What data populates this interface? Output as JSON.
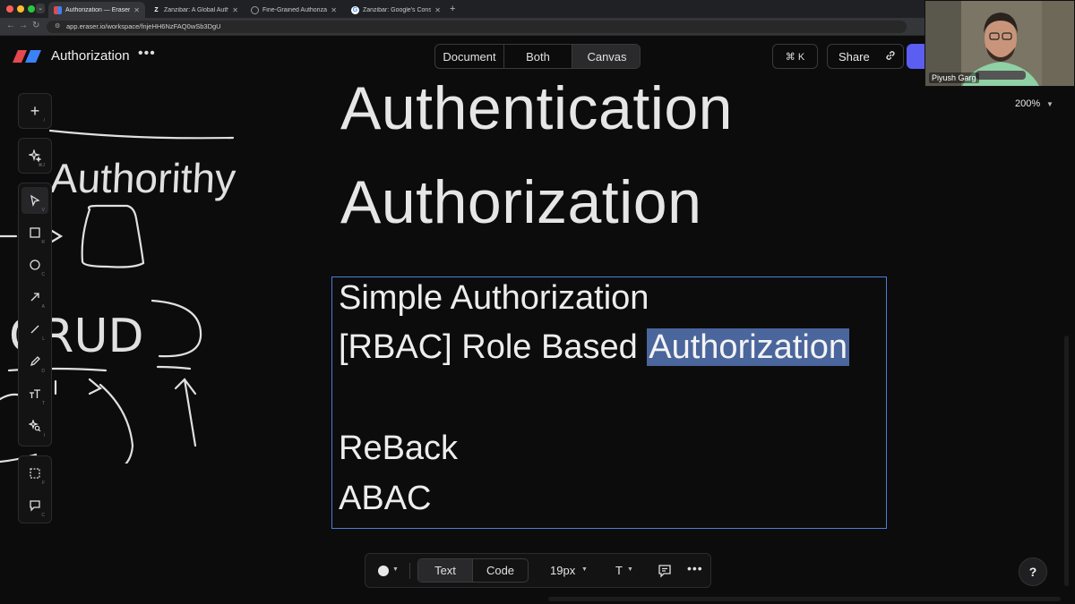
{
  "browser": {
    "tabs": [
      {
        "label": "Authorization — Eraser",
        "favicon": "eraser",
        "active": true
      },
      {
        "label": "Zanzibar: A Global Authorizati",
        "favicon": "Z",
        "active": false
      },
      {
        "label": "Fine-Grained Authorization |",
        "favicon": "globe",
        "active": false
      },
      {
        "label": "Zanzibar: Google's Consisten",
        "favicon": "G",
        "active": false
      }
    ],
    "url": "app.eraser.io/workspace/fnjeHH6NzFAQ0wSb3DgU",
    "new_tab_icon": "plus-icon"
  },
  "header": {
    "title": "Authorization",
    "menu_icon": "more-icon",
    "view_modes": [
      "Document",
      "Both",
      "Canvas"
    ],
    "active_view": "Canvas",
    "command_shortcut": "⌘ K",
    "share_label": "Share",
    "brand_color": "#5b5ef0"
  },
  "webcam": {
    "name": "Piyush Garg"
  },
  "canvas": {
    "zoom": "200%",
    "headings": [
      "Authentication",
      "Authorization"
    ],
    "sketch_text": "Authorithy",
    "sketch_crud": "CRUD",
    "textbox": {
      "lines": [
        "Simple Authorization",
        "[RBAC] Role Based ",
        "ReBack",
        "ABAC"
      ],
      "selected_word": "Authorization",
      "selection_color": "#4a669c"
    }
  },
  "left_toolbar": {
    "tools": [
      {
        "name": "add",
        "key": "/"
      },
      {
        "name": "ai",
        "key": "⌘J"
      },
      {
        "name": "select",
        "key": "V"
      },
      {
        "name": "rectangle",
        "key": "R"
      },
      {
        "name": "circle",
        "key": "C"
      },
      {
        "name": "arrow",
        "key": "A"
      },
      {
        "name": "line",
        "key": "L"
      },
      {
        "name": "pen",
        "key": "D"
      },
      {
        "name": "text",
        "key": "T"
      },
      {
        "name": "shapes-search",
        "key": "I"
      },
      {
        "name": "frame",
        "key": "F"
      },
      {
        "name": "comment",
        "key": "C"
      }
    ]
  },
  "bottom_toolbar": {
    "modes": [
      "Text",
      "Code"
    ],
    "active_mode": "Text",
    "font_size": "19px",
    "text_style": "T"
  },
  "help_label": "?"
}
